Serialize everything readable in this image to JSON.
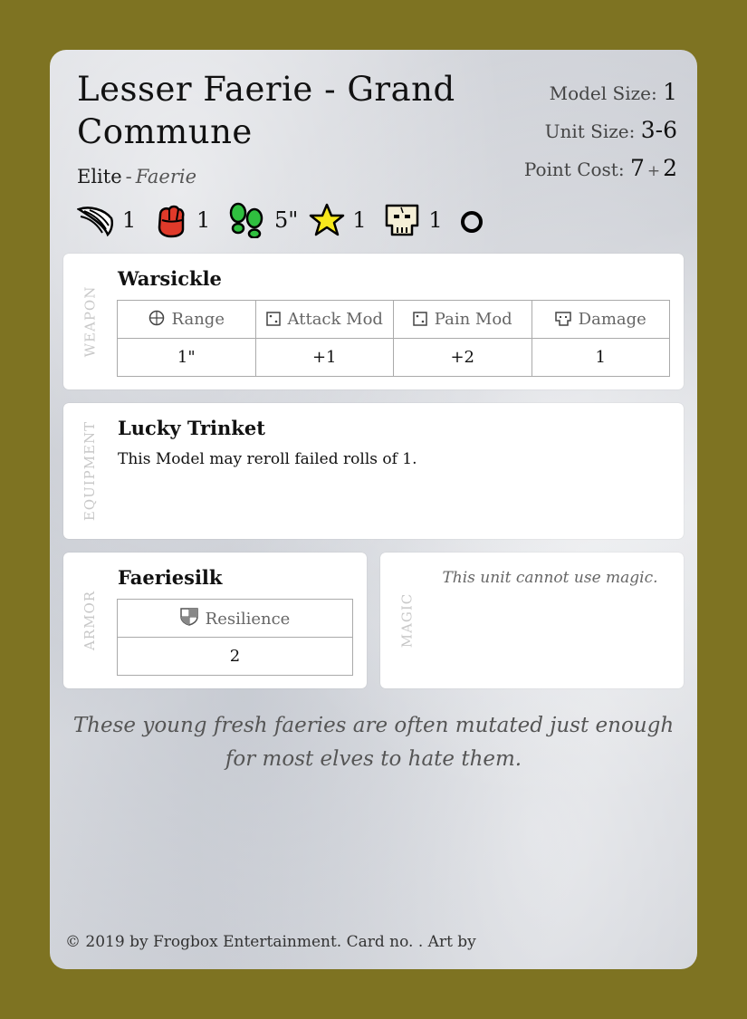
{
  "card": {
    "title": "Lesser Faerie - Grand Commune",
    "rank": "Elite",
    "separator": "-",
    "faction": "Faerie",
    "model_size_label": "Model Size:",
    "model_size": "1",
    "unit_size_label": "Unit Size:",
    "unit_size": "3-6",
    "point_cost_label": "Point Cost:",
    "point_cost_base": "7",
    "point_cost_plus": "+",
    "point_cost_extra": "2"
  },
  "stats": [
    {
      "icon": "wing-icon",
      "value": "1"
    },
    {
      "icon": "fist-icon",
      "value": "1"
    },
    {
      "icon": "footprints-icon",
      "value": "5\""
    },
    {
      "icon": "star-icon",
      "value": "1"
    },
    {
      "icon": "skull-icon",
      "value": "1"
    },
    {
      "icon": "ring-icon",
      "value": ""
    }
  ],
  "weapon": {
    "section_label": "WEAPON",
    "name": "Warsickle",
    "headers": [
      "Range",
      "Attack Mod",
      "Pain Mod",
      "Damage"
    ],
    "values": [
      "1\"",
      "+1",
      "+2",
      "1"
    ]
  },
  "equipment": {
    "section_label": "EQUIPMENT",
    "name": "Lucky Trinket",
    "text": "This Model may reroll failed rolls of 1."
  },
  "armor": {
    "section_label": "ARMOR",
    "name": "Faeriesilk",
    "header": "Resilience",
    "value": "2"
  },
  "magic": {
    "section_label": "MAGIC",
    "text": "This unit cannot use magic."
  },
  "flavor": {
    "line1": "These young fresh faeries are often mutated just enough",
    "line2": "for most elves to hate them."
  },
  "footer": "© 2019 by Frogbox Entertainment. Card no. . Art by",
  "colors": {
    "border": "#7e7322",
    "fist": "#e03a2a",
    "footprints": "#2fbf3f",
    "star": "#f7e81c"
  }
}
